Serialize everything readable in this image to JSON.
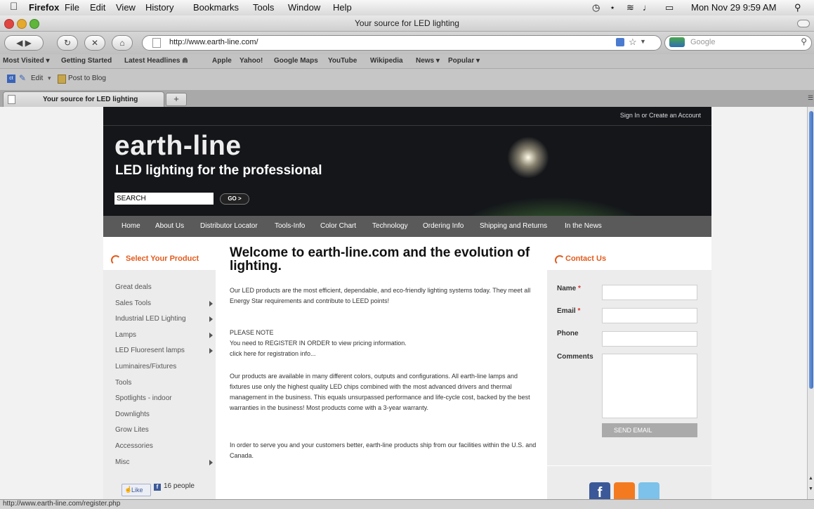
{
  "menubar": {
    "app": "Firefox",
    "items": [
      "File",
      "Edit",
      "View",
      "History",
      "Bookmarks",
      "Tools",
      "Window",
      "Help"
    ],
    "clock": "Mon Nov 29  9:59 AM"
  },
  "window": {
    "title": "Your source for LED lighting"
  },
  "toolbar": {
    "url": "http://www.earth-line.com/",
    "search_placeholder": "Google"
  },
  "bookmarks": [
    "Most Visited ▾",
    "Getting Started",
    "Latest Headlines ⋒",
    "Apple",
    "Yahoo!",
    "Google Maps",
    "YouTube",
    "Wikipedia",
    "News ▾",
    "Popular ▾"
  ],
  "addons": {
    "edit": "Edit",
    "post": "Post to Blog"
  },
  "tab": {
    "title": "Your source for LED lighting",
    "new_tab": "+"
  },
  "site": {
    "signin": "Sign In or Create an Account",
    "logo": "earth-line",
    "tagline": "LED lighting for the professional",
    "search_value": "SEARCH",
    "go": "GO >",
    "nav": [
      "Home",
      "About Us",
      "Distributor Locator",
      "Tools-Info",
      "Color Chart",
      "Technology",
      "Ordering Info",
      "Shipping and Returns",
      "In the News"
    ],
    "left_title": "Select Your Product",
    "products": [
      {
        "label": "Great deals",
        "arrow": false
      },
      {
        "label": "Sales Tools",
        "arrow": true
      },
      {
        "label": "Industrial LED Lighting",
        "arrow": true
      },
      {
        "label": "Lamps",
        "arrow": true
      },
      {
        "label": "LED Fluoresent lamps",
        "arrow": true
      },
      {
        "label": "Luminaires/Fixtures",
        "arrow": false
      },
      {
        "label": "Tools",
        "arrow": false
      },
      {
        "label": "Spotlights - indoor",
        "arrow": false
      },
      {
        "label": "Downlights",
        "arrow": false
      },
      {
        "label": "Grow Lites",
        "arrow": false
      },
      {
        "label": "Accessories",
        "arrow": false
      },
      {
        "label": "Misc",
        "arrow": true
      }
    ],
    "welcome": "Welcome to earth-line.com and the evolution of lighting.",
    "intro": "Our LED products are the most efficient, dependable, and eco-friendly lighting systems today. They meet all Energy Star requirements and contribute to LEED points!",
    "note_title": "PLEASE NOTE",
    "note_line1": "You need to REGISTER IN ORDER to view pricing information.",
    "note_link": "click here for registration info...",
    "body1": "Our products are available in many different colors, outputs and configurations.  All earth-line lamps and fixtures use only the highest quality LED chips combined with the most advanced drivers and thermal management in the business. This equals unsurpassed performance and life-cycle cost, backed by the best warranties in the business! Most products come with a 3-year warranty.",
    "body2": "In order to serve you and your customers better, earth-line products ship from our facilities within the U.S. and Canada.",
    "contact_title": "Contact Us",
    "form": {
      "name": "Name",
      "email": "Email",
      "phone": "Phone",
      "comments": "Comments",
      "send": "SEND EMAIL",
      "required_mark": "*"
    },
    "like": "Like",
    "like_count": "16 people"
  },
  "status": "http://www.earth-line.com/register.php",
  "colors": {
    "accent": "#e35a1c",
    "nav_bg": "#5a5a5a",
    "facebook": "#3b5998",
    "rss": "#f47a20",
    "twitter": "#4aa8e0"
  }
}
